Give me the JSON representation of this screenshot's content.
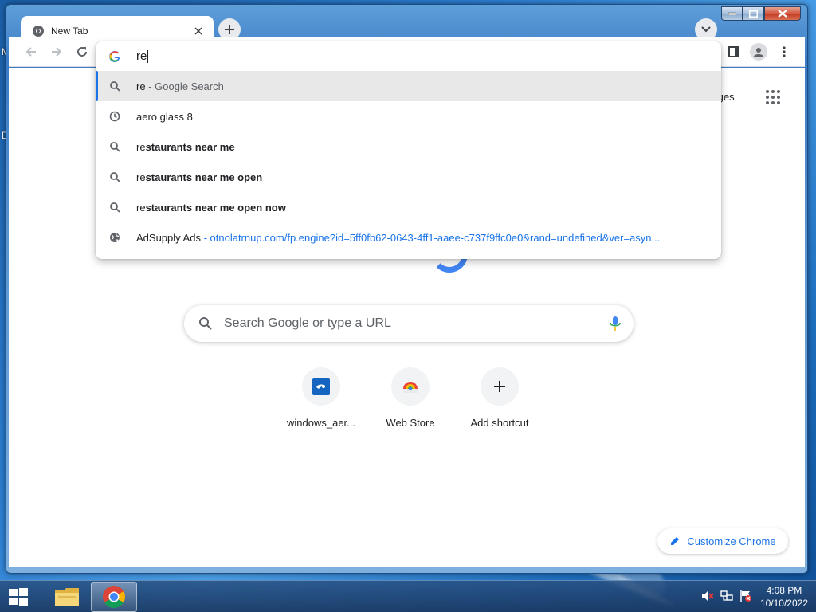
{
  "browser": {
    "tab": {
      "title": "New Tab"
    },
    "omnibox": {
      "input_value": "re",
      "suggestions": [
        {
          "icon": "search-icon",
          "typed": "re",
          "completion": "",
          "desc": "- Google Search",
          "url": ""
        },
        {
          "icon": "history-icon",
          "typed": "aero glass 8",
          "completion": "",
          "desc": "",
          "url": ""
        },
        {
          "icon": "search-icon",
          "typed": "re",
          "completion": "staurants near me",
          "desc": "",
          "url": ""
        },
        {
          "icon": "search-icon",
          "typed": "re",
          "completion": "staurants near me open",
          "desc": "",
          "url": ""
        },
        {
          "icon": "search-icon",
          "typed": "re",
          "completion": "staurants near me open now",
          "desc": "",
          "url": ""
        },
        {
          "icon": "globe-icon",
          "typed": "AdSupply Ads",
          "completion": "",
          "desc": "",
          "url": "- otnolatrnup.com/fp.engine?id=5ff0fb62-0643-4ff1-aaee-c737f9ffc0e0&rand=undefined&ver=asyn..."
        }
      ]
    }
  },
  "page": {
    "images_link": "Images",
    "search_placeholder": "Search Google or type a URL",
    "shortcuts": [
      {
        "label": "windows_aer...",
        "icon": "site-favicon-icon"
      },
      {
        "label": "Web Store",
        "icon": "web-store-icon"
      },
      {
        "label": "Add shortcut",
        "icon": "plus-icon"
      }
    ],
    "customize_label": "Customize Chrome"
  },
  "taskbar": {
    "time": "4:08 PM",
    "date": "10/10/2022"
  },
  "colors": {
    "accent": "#1a73e8",
    "google_blue": "#4285f4"
  }
}
